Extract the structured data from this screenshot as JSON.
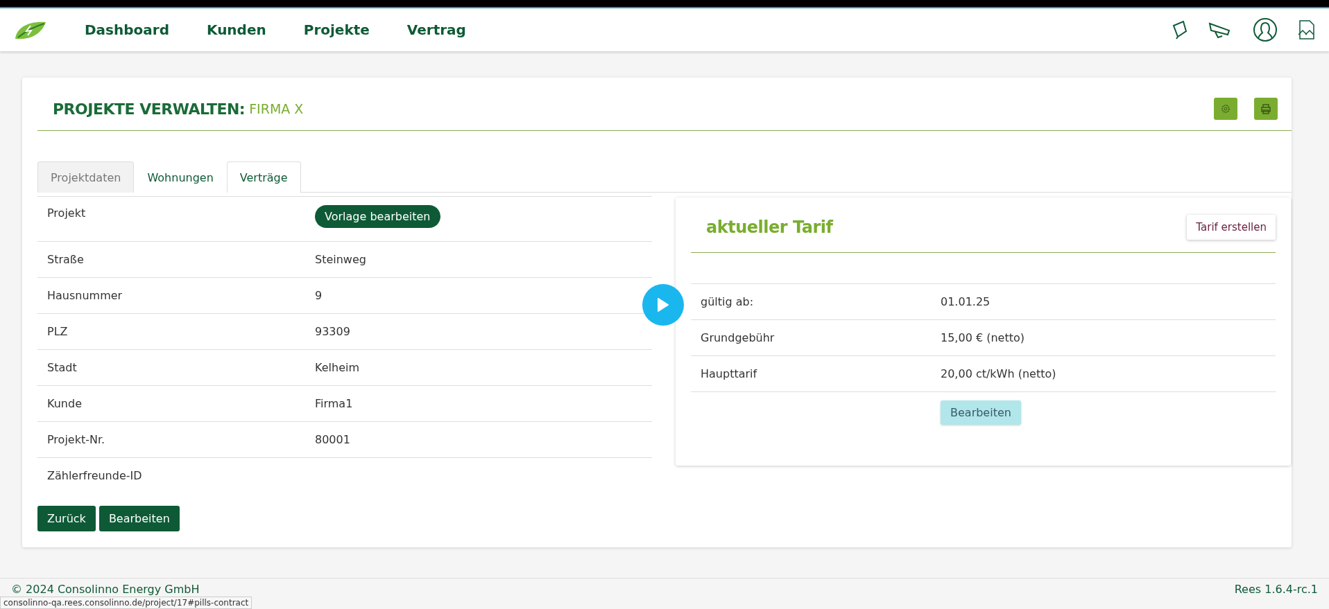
{
  "nav": {
    "items": [
      {
        "label": "Dashboard"
      },
      {
        "label": "Kunden"
      },
      {
        "label": "Projekte"
      },
      {
        "label": "Vertrag"
      }
    ]
  },
  "page": {
    "title": "PROJEKTE VERWALTEN:",
    "subtitle": "FIRMA X"
  },
  "tabs": [
    {
      "label": "Projektdaten",
      "selected": true,
      "hovered": false
    },
    {
      "label": "Wohnungen",
      "selected": false,
      "hovered": false
    },
    {
      "label": "Verträge",
      "selected": false,
      "hovered": true
    }
  ],
  "project_fields": [
    {
      "label": "Projekt",
      "kind": "button",
      "value": "Vorlage bearbeiten"
    },
    {
      "label": "Straße",
      "kind": "text",
      "value": "Steinweg"
    },
    {
      "label": "Hausnummer",
      "kind": "text",
      "value": "9"
    },
    {
      "label": "PLZ",
      "kind": "text",
      "value": "93309"
    },
    {
      "label": "Stadt",
      "kind": "text",
      "value": "Kelheim"
    },
    {
      "label": "Kunde",
      "kind": "text",
      "value": "Firma1"
    },
    {
      "label": "Projekt-Nr.",
      "kind": "text",
      "value": "80001"
    },
    {
      "label": "Zählerfreunde-ID",
      "kind": "text"
    }
  ],
  "actions": [
    "Zurück",
    "Bearbeiten"
  ],
  "tariff": {
    "title": "aktueller Tarif",
    "create_button": "Tarif erstellen",
    "rows": [
      {
        "label": "gültig ab:",
        "value": "01.01.25"
      },
      {
        "label": "Grundgebühr",
        "value": "15,00 € (netto)"
      },
      {
        "label": "Haupttarif",
        "value": "20,00 ct/kWh (netto)"
      }
    ],
    "edit_button": "Bearbeiten"
  },
  "footer": {
    "copyright": "© 2024 Consolinno Energy GmbH",
    "version": "Rees 1.6.4-rc.1"
  },
  "status_url": "consolinno-qa.rees.consolinno.de/project/17#pills-contract"
}
